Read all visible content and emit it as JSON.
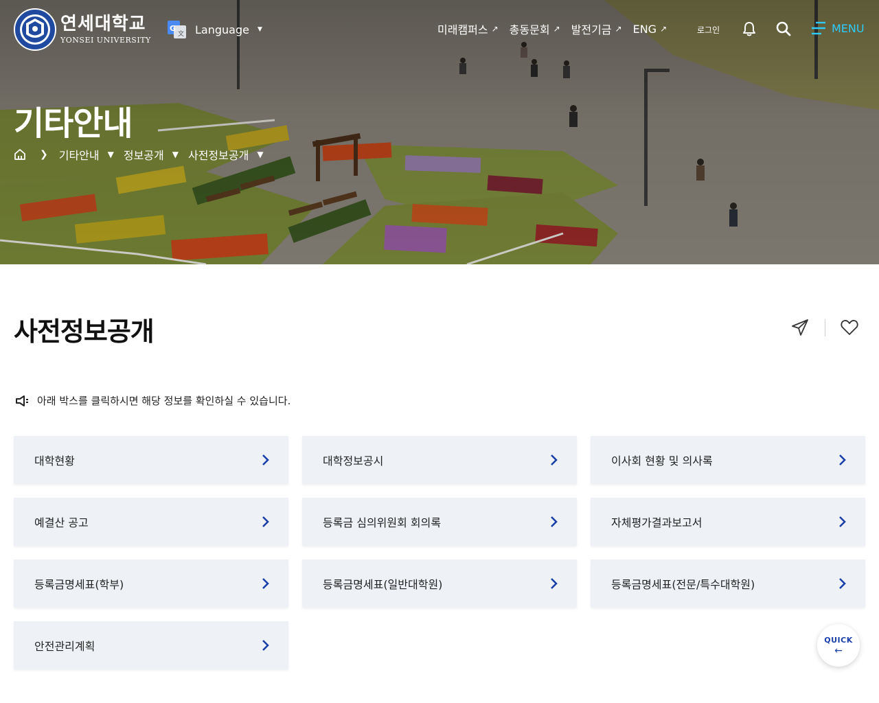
{
  "brand": {
    "name_ko": "연세대학교",
    "name_en": "YONSEI UNIVERSITY",
    "icon": "yonsei-seal-logo"
  },
  "header": {
    "language_label": "Language",
    "language_icon": "google-translate-icon",
    "nav": [
      {
        "label": "미래캠퍼스"
      },
      {
        "label": "총동문회"
      },
      {
        "label": "발전기금"
      },
      {
        "label": "ENG"
      }
    ],
    "login_label": "로그인",
    "menu_label": "MENU",
    "accent_color": "#2ecbff"
  },
  "hero": {
    "title": "기타안내",
    "breadcrumb": [
      {
        "label": "기타안내"
      },
      {
        "label": "정보공개"
      },
      {
        "label": "사전정보공개"
      }
    ]
  },
  "main": {
    "title": "사전정보공개",
    "notice": "아래 박스를 클릭하시면 해당 정보를 확인하실 수 있습니다.",
    "cards": [
      {
        "label": "대학현황"
      },
      {
        "label": "대학정보공시"
      },
      {
        "label": "이사회 현황 및 의사록"
      },
      {
        "label": "예결산 공고"
      },
      {
        "label": "등록금 심의위원회 회의록"
      },
      {
        "label": "자체평가결과보고서"
      },
      {
        "label": "등록금명세표(학부)"
      },
      {
        "label": "등록금명세표(일반대학원)"
      },
      {
        "label": "등록금명세표(전문/특수대학원)"
      },
      {
        "label": "안전관리계획"
      }
    ],
    "card_color": "#eef2f7",
    "chevron_color": "#1a3fa8"
  },
  "quick": {
    "label": "QUICK",
    "arrow": "←"
  }
}
